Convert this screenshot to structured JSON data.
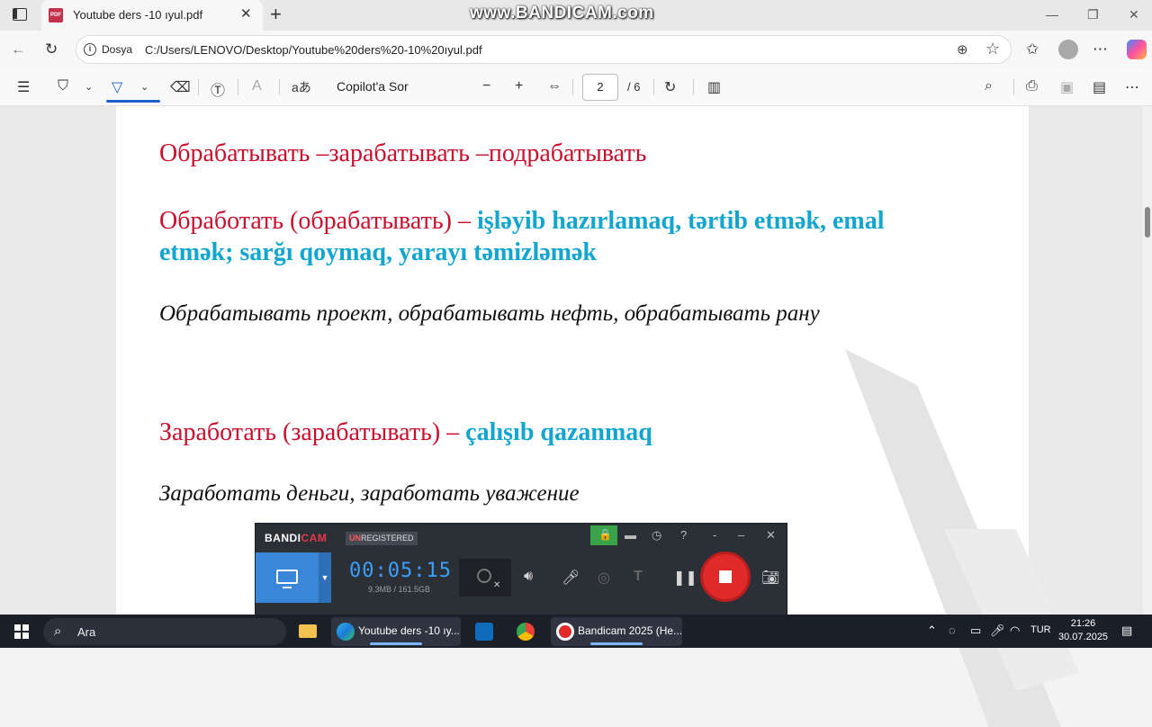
{
  "browser": {
    "tab_title": "Youtube ders -10 ıyul.pdf",
    "tab_close": "✕",
    "new_tab": "+",
    "watermark": "www.BANDICAM.com",
    "address_scheme_label": "Dosya",
    "address_url": "C:/Users/LENOVO/Desktop/Youtube%20ders%20-10%20ıyul.pdf"
  },
  "pdf_toolbar": {
    "copilot_label": "Copilot'a Sor",
    "page_current": "2",
    "page_total": "/ 6",
    "read_aloud_glyph": "aあ"
  },
  "document": {
    "line1": "Обрабатывать –зарабатывать –подрабатывать",
    "line2_ru": "Обработать (обрабатывать) –",
    "line2_az": "işləyib hazırlamaq, tərtib etmək, emal",
    "line3_az": "etmək; sarğı qoymaq, yarayı təmizləmək",
    "line4": "Обрабатывать проект, обрабатывать нефть, обрабатывать рану",
    "line5_ru": "Заработать (зарабатывать) –",
    "line5_az": "çalışıb qazanmaq",
    "line6": "Заработать деньги, заработать уважение"
  },
  "bandicam": {
    "logo_a": "BANDI",
    "logo_b": "CAM",
    "reg_un": "UN",
    "reg_rest": "REGISTERED",
    "timer": "00:05:15",
    "size": "9.3MB / 161.5GB",
    "help": "?",
    "minimize": "-",
    "restore": "–",
    "close": "✕"
  },
  "taskbar": {
    "search_label": "Ara",
    "app_edge": "Youtube ders -10 ıy...",
    "app_bandicam": "Bandicam 2025 (He...",
    "lang": "TUR",
    "time": "21:26",
    "date": "30.07.2025"
  },
  "colors": {
    "doc_red": "#c8102e",
    "doc_blue": "#12a5d0",
    "bandicam_blue": "#3a86d8",
    "record_red": "#e02a2a"
  }
}
